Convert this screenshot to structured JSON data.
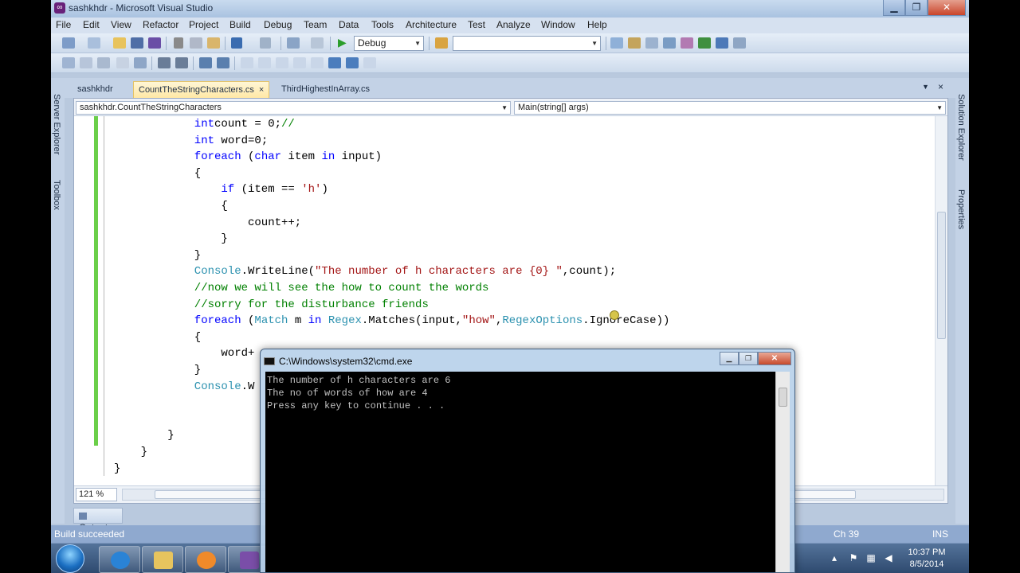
{
  "window": {
    "title": "sashkhdr - Microsoft Visual Studio"
  },
  "menu": [
    "File",
    "Edit",
    "View",
    "Refactor",
    "Project",
    "Build",
    "Debug",
    "Team",
    "Data",
    "Tools",
    "Architecture",
    "Test",
    "Analyze",
    "Window",
    "Help"
  ],
  "toolbar": {
    "configuration": "Debug",
    "find_value": ""
  },
  "side_panels": {
    "left": [
      "Server Explorer",
      "Toolbox"
    ],
    "right": [
      "Solution Explorer",
      "Properties"
    ]
  },
  "doc_tabs": [
    {
      "label": "sashkhdr",
      "active": false
    },
    {
      "label": "CountTheStringCharacters.cs",
      "active": true
    },
    {
      "label": "ThirdHighestInArray.cs",
      "active": false
    }
  ],
  "tab_close_glyph": "×",
  "navigation": {
    "type_combo": "sashkhdr.CountTheStringCharacters",
    "member_combo": "Main(string[] args)"
  },
  "code_lines": [
    {
      "indent": 12,
      "tokens": [
        [
          "kw",
          "int"
        ],
        [
          "",
          "count = 0;"
        ],
        [
          "cm",
          "//"
        ]
      ]
    },
    {
      "indent": 12,
      "tokens": [
        [
          "kw",
          "int"
        ],
        [
          "",
          " word=0;"
        ]
      ]
    },
    {
      "indent": 12,
      "tokens": [
        [
          "kw",
          "foreach"
        ],
        [
          "",
          " ("
        ],
        [
          "kw",
          "char"
        ],
        [
          "",
          " item "
        ],
        [
          "kw",
          "in"
        ],
        [
          "",
          " input)"
        ]
      ]
    },
    {
      "indent": 12,
      "tokens": [
        [
          "",
          "{"
        ]
      ]
    },
    {
      "indent": 16,
      "tokens": [
        [
          "kw",
          "if"
        ],
        [
          "",
          " (item == "
        ],
        [
          "str",
          "'h'"
        ],
        [
          "",
          ")"
        ]
      ]
    },
    {
      "indent": 16,
      "tokens": [
        [
          "",
          "{"
        ]
      ]
    },
    {
      "indent": 20,
      "tokens": [
        [
          "",
          "count++;"
        ]
      ]
    },
    {
      "indent": 16,
      "tokens": [
        [
          "",
          "}"
        ]
      ]
    },
    {
      "indent": 12,
      "tokens": [
        [
          "",
          "}"
        ]
      ]
    },
    {
      "indent": 12,
      "tokens": [
        [
          "ty",
          "Console"
        ],
        [
          "",
          ".WriteLine("
        ],
        [
          "str",
          "\"The number of h characters are {0} \""
        ],
        [
          "",
          ",count);"
        ]
      ]
    },
    {
      "indent": 12,
      "tokens": [
        [
          "cm",
          "//now we will see the how to count the words"
        ]
      ]
    },
    {
      "indent": 12,
      "tokens": [
        [
          "cm",
          "//sorry for the disturbance friends"
        ]
      ]
    },
    {
      "indent": 12,
      "tokens": [
        [
          "kw",
          "foreach"
        ],
        [
          "",
          " ("
        ],
        [
          "ty",
          "Match"
        ],
        [
          "",
          " m "
        ],
        [
          "kw",
          "in"
        ],
        [
          "",
          " "
        ],
        [
          "ty",
          "Regex"
        ],
        [
          "",
          ".Matches(input,"
        ],
        [
          "str",
          "\"how\""
        ],
        [
          "",
          ","
        ],
        [
          "ty",
          "RegexOptions"
        ],
        [
          "",
          ".IgnoreCase))"
        ]
      ]
    },
    {
      "indent": 12,
      "tokens": [
        [
          "",
          "{"
        ]
      ]
    },
    {
      "indent": 16,
      "tokens": [
        [
          "",
          "word+"
        ]
      ]
    },
    {
      "indent": 12,
      "tokens": [
        [
          "",
          "}"
        ]
      ]
    },
    {
      "indent": 12,
      "tokens": [
        [
          "ty",
          "Console"
        ],
        [
          "",
          ".W"
        ]
      ]
    },
    {
      "indent": 0,
      "tokens": []
    },
    {
      "indent": 0,
      "tokens": []
    },
    {
      "indent": 8,
      "tokens": [
        [
          "",
          "}"
        ]
      ]
    },
    {
      "indent": 4,
      "tokens": [
        [
          "",
          "}"
        ]
      ]
    },
    {
      "indent": 0,
      "tokens": [
        [
          "",
          "}"
        ]
      ]
    }
  ],
  "editor": {
    "zoom": "121 %"
  },
  "output_tab": "Output",
  "status": {
    "message": "Build succeeded",
    "column": "Ch 39",
    "mode": "INS"
  },
  "cmd": {
    "title": "C:\\Windows\\system32\\cmd.exe",
    "lines": [
      "The number of h characters are 6",
      "The no of words of how are 4",
      "Press any key to continue . . ."
    ]
  },
  "clock": {
    "time": "10:37 PM",
    "date": "8/5/2014"
  },
  "colors": {
    "keyword": "#0000ff",
    "type": "#2b91af",
    "string": "#a31515",
    "comment": "#008000",
    "change_bar": "#6bcf49"
  },
  "taskbar_apps": [
    "internet-explorer-icon",
    "file-explorer-icon",
    "media-player-icon",
    "visual-studio-icon",
    "chrome-icon",
    "tools-icon",
    "save-icon",
    "notepad-icon",
    "powerpoint-icon",
    "cmd-icon"
  ]
}
